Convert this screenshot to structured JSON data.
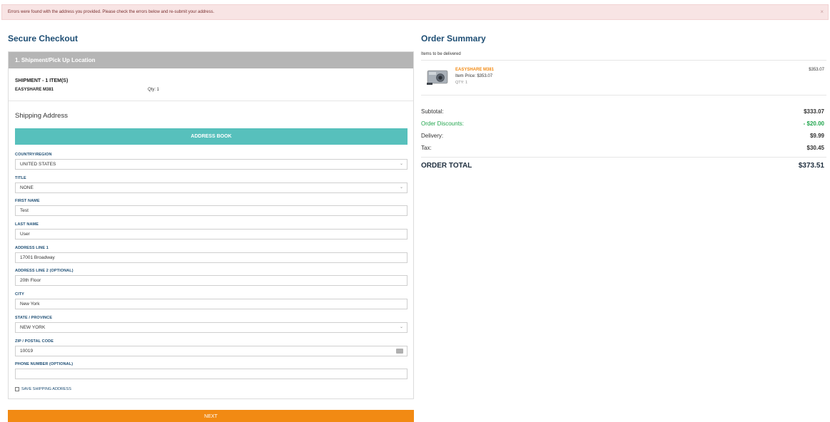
{
  "error": {
    "message": "Errors were found with the address you provided. Please check the errors below and re-submit your address.",
    "close": "×"
  },
  "checkout": {
    "title": "Secure Checkout",
    "step_header": "1. Shipment/Pick Up Location",
    "shipment_title": "SHIPMENT - 1 ITEM(S)",
    "item_name": "EASYSHARE M381",
    "qty": "Qty: 1",
    "shipping_address_title": "Shipping Address",
    "address_book_label": "ADDRESS BOOK",
    "fields": {
      "country": {
        "label": "COUNTRY/REGION",
        "value": "UNITED STATES"
      },
      "title": {
        "label": "TITLE",
        "value": "NONE"
      },
      "first_name": {
        "label": "FIRST NAME",
        "value": "Test"
      },
      "last_name": {
        "label": "LAST NAME",
        "value": "User"
      },
      "address1": {
        "label": "ADDRESS LINE 1",
        "value": "17001 Broadway"
      },
      "address2": {
        "label": "ADDRESS LINE 2 (OPTIONAL)",
        "value": "20th Floor"
      },
      "city": {
        "label": "CITY",
        "value": "New York"
      },
      "state": {
        "label": "STATE / PROVINCE",
        "value": "NEW YORK"
      },
      "zip": {
        "label": "ZIP / POSTAL CODE",
        "value": "10019"
      },
      "phone": {
        "label": "PHONE NUMBER (OPTIONAL)",
        "value": ""
      }
    },
    "save_address_label": "SAVE SHIPPING ADDRESS",
    "next_label": "NEXT"
  },
  "summary": {
    "title": "Order Summary",
    "items_label": "Items to be delivered",
    "product": {
      "name": "EASYSHARE M381",
      "price": "Item Price:  $353.07",
      "qty": "QTY:  1",
      "total": "$353.07"
    },
    "subtotal": {
      "label": "Subtotal:",
      "value": "$333.07"
    },
    "discounts": {
      "label": "Order Discounts:",
      "value": "- $20.00"
    },
    "delivery": {
      "label": "Delivery:",
      "value": "$9.99"
    },
    "tax": {
      "label": "Tax:",
      "value": "$30.45"
    },
    "order_total": {
      "label": "ORDER TOTAL",
      "value": "$373.51"
    }
  },
  "colors": {
    "brand_blue": "#1e4e74",
    "teal": "#57c0bc",
    "orange": "#f28a13",
    "discount_green": "#22a64e",
    "error_bg": "#f8e4e4"
  },
  "icons": {
    "select": "chevron-down-icon",
    "zip": "keyboard-icon",
    "close": "close-icon",
    "product": "camera-image"
  }
}
